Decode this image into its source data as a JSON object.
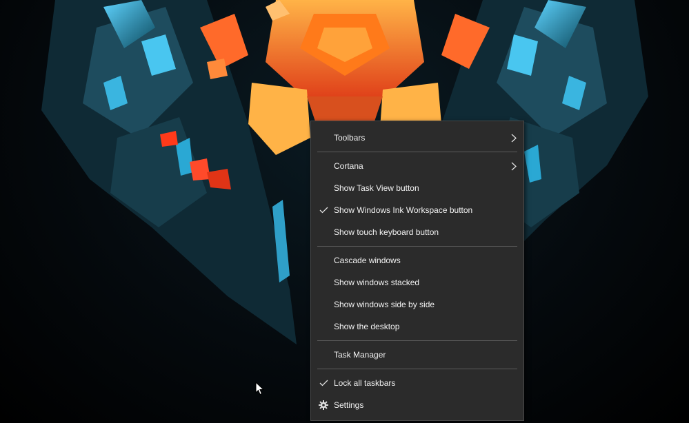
{
  "menu": {
    "toolbars": "Toolbars",
    "cortana": "Cortana",
    "show_task_view": "Show Task View button",
    "show_ink_workspace": "Show Windows Ink Workspace button",
    "show_touch_keyboard": "Show touch keyboard button",
    "cascade_windows": "Cascade windows",
    "show_stacked": "Show windows stacked",
    "show_side_by_side": "Show windows side by side",
    "show_desktop": "Show the desktop",
    "task_manager": "Task Manager",
    "lock_taskbars": "Lock all taskbars",
    "settings": "Settings"
  },
  "checked": {
    "show_ink_workspace": true,
    "lock_taskbars": true
  },
  "icons": {
    "submenu": "chevron-right-icon",
    "check": "checkmark-icon",
    "settings": "gear-icon",
    "pointer": "mouse-cursor-icon"
  },
  "colors": {
    "menu_bg": "#2b2b2b",
    "menu_text": "#f2f2f2",
    "separator": "#5c5c5c"
  }
}
